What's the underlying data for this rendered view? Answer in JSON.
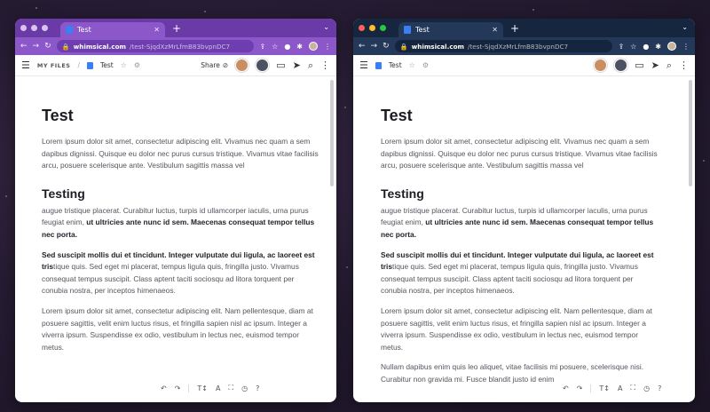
{
  "colors": {
    "left_chrome": "#8b57c9",
    "right_chrome": "#24385a",
    "traffic_red": "#ff5f57",
    "traffic_yellow": "#febc2e",
    "traffic_green": "#28c840",
    "doc_blue": "#3b7ff3"
  },
  "browser_left": {
    "tab_title": "Test",
    "url_domain": "whimsical.com",
    "url_path": "/test-SjqdXzMrLfmB83bvpnDC7",
    "icons": [
      "back-arrow-icon",
      "forward-arrow-icon",
      "reload-icon",
      "lock-icon",
      "share-icon",
      "star-icon",
      "extension-icon",
      "puzzle-icon",
      "avatar",
      "menu-kebab-icon"
    ]
  },
  "browser_right": {
    "tab_title": "Test",
    "url_domain": "whimsical.com",
    "url_path": "/test-SjqdXzMrLfmB83bvpnDC7",
    "icons": [
      "back-arrow-icon",
      "forward-arrow-icon",
      "reload-icon",
      "lock-icon",
      "share-icon",
      "star-icon",
      "extension-icon",
      "puzzle-icon",
      "avatar",
      "menu-kebab-icon"
    ]
  },
  "app_left": {
    "breadcrumb_files": "MY FILES",
    "breadcrumb_sep": "/",
    "doc_title": "Test",
    "share_label": "Share",
    "icons": [
      "hamburger-icon",
      "doc-icon",
      "star-icon",
      "gear-icon",
      "globe-icon",
      "comment-icon",
      "send-icon",
      "search-icon",
      "more-icon"
    ]
  },
  "app_right": {
    "doc_title": "Test",
    "icons": [
      "hamburger-icon",
      "doc-icon",
      "star-icon",
      "gear-icon",
      "comment-icon",
      "send-icon",
      "search-icon",
      "more-icon"
    ]
  },
  "doc_left": {
    "heading": "Test",
    "p1": "Lorem ipsum dolor sit amet, consectetur adipiscing elit. Vivamus nec quam a sem dapibus dignissi. Quisque eu dolor nec purus cursus tristique. Vivamus vitae facilisis arcu, posuere scelerisque ante. Vestibulum sagittis massa vel",
    "h2": "Testing",
    "p2_start": "augue tristique placerat. Curabitur luctus, turpis id ullamcorper iaculis, urna purus feugiat enim, ",
    "p2_bold": "ut ultricies ante nunc id sem. Maecenas consequat tempor tellus nec porta.",
    "p3_bold": "Sed suscipit mollis dui et tincidunt. Integer vulputate dui ligula, ac laoreet est tris",
    "p3_rest": "tique quis. Sed eget mi placerat, tempus ligula quis, fringilla justo. Vivamus consequat tempus suscipit. Class aptent taciti sociosqu ad litora torquent per conubia nostra, per inceptos himenaeos.",
    "p4": "Lorem ipsum dolor sit amet, consectetur adipiscing elit. Nam pellentesque, diam at posuere sagittis, velit enim luctus risus, et fringilla sapien nisl ac ipsum. Integer a viverra ipsum. Suspendisse ex odio, vestibulum in lectus nec, euismod tempor metus."
  },
  "doc_right": {
    "heading": "Test",
    "p1": "Lorem ipsum dolor sit amet, consectetur adipiscing elit. Vivamus nec quam a sem dapibus dignissi. Quisque eu dolor nec purus cursus tristique. Vivamus vitae facilisis arcu, posuere scelerisque ante. Vestibulum sagittis massa vel",
    "h2": "Testing",
    "p2_start": "augue tristique placerat. Curabitur luctus, turpis id ullamcorper iaculis, urna purus feugiat enim, ",
    "p2_bold": "ut ultricies ante nunc id sem. Maecenas consequat tempor tellus nec porta.",
    "p3_bold": "Sed suscipit mollis dui et tincidunt. Integer vulputate dui ligula, ac laoreet est tris",
    "p3_rest": "tique quis. Sed eget mi placerat, tempus ligula quis, fringilla justo. Vivamus consequat tempus suscipit. Class aptent taciti sociosqu ad litora torquent per conubia nostra, per inceptos himenaeos.",
    "p4": "Lorem ipsum dolor sit amet, consectetur adipiscing elit. Nam pellentesque, diam at posuere sagittis, velit enim luctus risus, et fringilla sapien nisl ac ipsum. Integer a viverra ipsum. Suspendisse ex odio, vestibulum in lectus nec, euismod tempor metus.",
    "p5": "Nullam dapibus enim quis leo aliquet, vitae facilisis mi posuere, scelerisque nisi. Curabitur non gravida mi. Fusce blandit justo id enim"
  },
  "bottom_toolbar": {
    "icons": [
      "undo-icon",
      "redo-icon",
      "text-size-icon",
      "font-icon",
      "focus-icon",
      "history-icon",
      "help-icon"
    ],
    "help_label": "?"
  }
}
